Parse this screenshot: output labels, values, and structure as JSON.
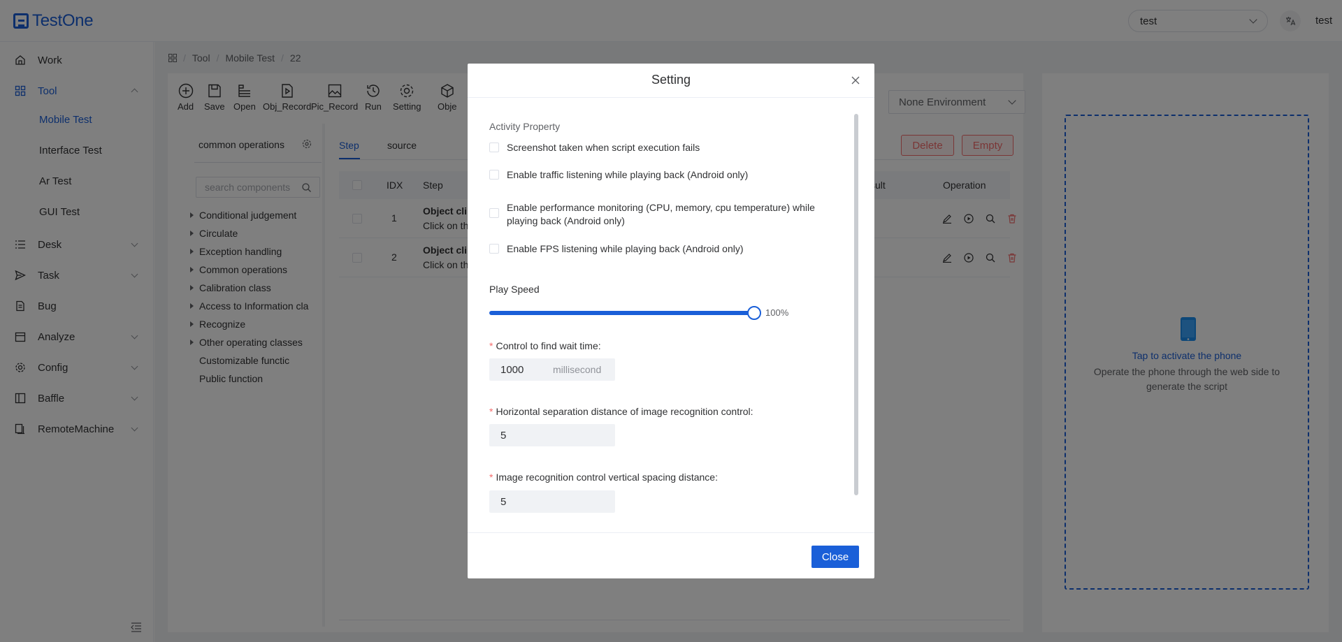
{
  "app": {
    "brand": "TestOne",
    "brand_color": "#1a5fd8"
  },
  "header": {
    "project": "test",
    "user": "test"
  },
  "sidebar": {
    "items": [
      {
        "label": "Work"
      },
      {
        "label": "Tool"
      },
      {
        "label": "Desk"
      },
      {
        "label": "Task"
      },
      {
        "label": "Bug"
      },
      {
        "label": "Analyze"
      },
      {
        "label": "Config"
      },
      {
        "label": "Baffle"
      },
      {
        "label": "RemoteMachine"
      }
    ],
    "tool_sub": [
      "Mobile Test",
      "Interface Test",
      "Ar Test",
      "GUI Test"
    ]
  },
  "breadcrumb": [
    "Tool",
    "Mobile Test",
    "22"
  ],
  "toolbar": [
    "Add",
    "Save",
    "Open",
    "Obj_Record",
    "Pic_Record",
    "Run",
    "Setting",
    "Obje"
  ],
  "environment": "None Environment",
  "components": {
    "title": "common operations",
    "search_placeholder": "search components",
    "groups": [
      "Conditional judgement",
      "Circulate",
      "Exception handling",
      "Common operations",
      "Calibration class",
      "Access to Information cla",
      "Recognize",
      "Other operating classes"
    ],
    "leaves": [
      "Customizable functic",
      "Public function"
    ]
  },
  "tabs": [
    "Step",
    "source"
  ],
  "actions": {
    "delete": "Delete",
    "empty": "Empty"
  },
  "table": {
    "headers": {
      "idx": "IDX",
      "step": "Step",
      "result": "sult",
      "operation": "Operation"
    },
    "rows": [
      {
        "idx": "1",
        "name": "Object cli",
        "desc": "Click on th"
      },
      {
        "idx": "2",
        "name": "Object cli",
        "desc": "Click on th"
      }
    ]
  },
  "phone": {
    "link": "Tap to activate the phone",
    "desc": "Operate the phone through the web side to generate the script"
  },
  "modal": {
    "title": "Setting",
    "activity_label": "Activity Property",
    "options": [
      "Screenshot taken when script execution fails",
      "Enable traffic listening while playing back (Android only)",
      "Enable performance monitoring (CPU, memory, cpu temperature) while playing back (Android only)",
      "Enable FPS listening while playing back (Android only)"
    ],
    "speed_label": "Play Speed",
    "speed_value": "100%",
    "speed_fraction": 1.0,
    "wait_label": "Control to find wait time:",
    "wait_value": "1000",
    "wait_unit": "millisecond",
    "hsep_label": "Horizontal separation distance of image recognition control:",
    "hsep_value": "5",
    "vsep_label": "Image recognition control vertical spacing distance:",
    "vsep_value": "5",
    "close": "Close"
  }
}
